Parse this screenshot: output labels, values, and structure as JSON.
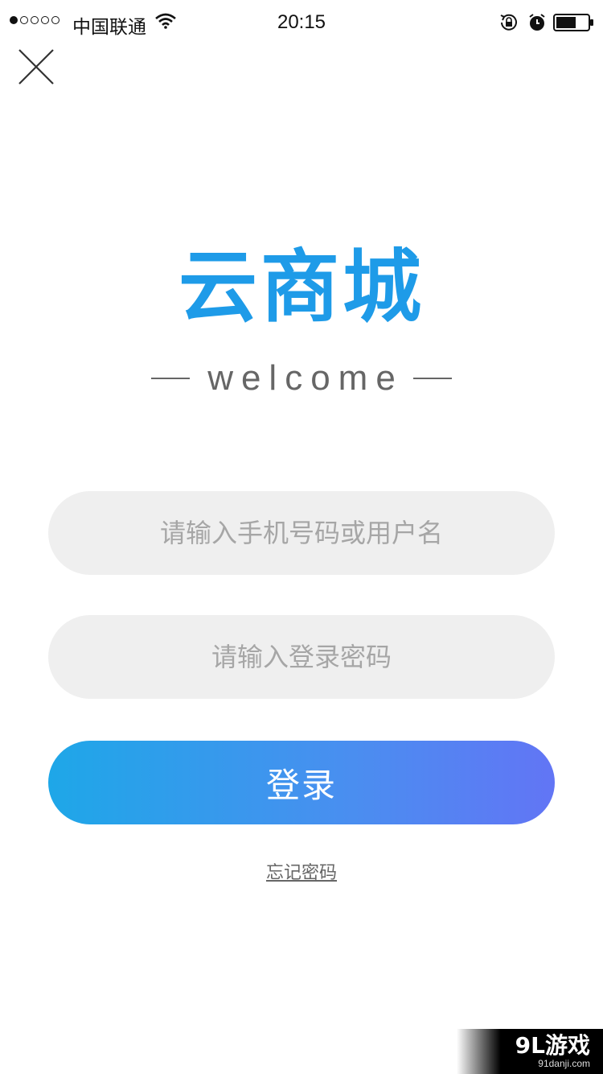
{
  "status_bar": {
    "carrier": "中国联通",
    "time": "20:15",
    "signal_bars_filled": 1,
    "signal_bars_total": 5,
    "battery_level": 0.6
  },
  "header": {
    "close_icon": "close-icon"
  },
  "logo": {
    "title": "云商城",
    "welcome": "welcome",
    "color": "#1e9be8"
  },
  "form": {
    "username_placeholder": "请输入手机号码或用户名",
    "username_value": "",
    "password_placeholder": "请输入登录密码",
    "password_value": "",
    "login_label": "登录",
    "forgot_label": "忘记密码"
  },
  "colors": {
    "button_gradient_start": "#1ea7e8",
    "button_gradient_end": "#6275f5",
    "input_background": "#efefef"
  },
  "watermark": {
    "main": "9L游戏",
    "sub": "91danji.com"
  }
}
